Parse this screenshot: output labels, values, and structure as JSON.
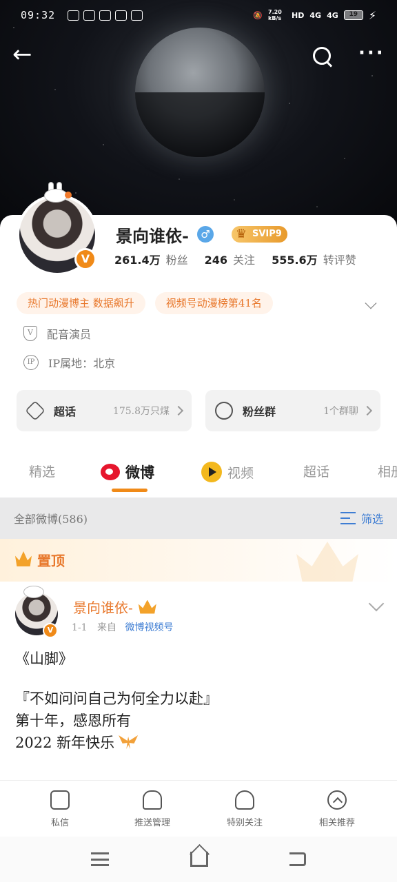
{
  "status_bar": {
    "time": "09:32",
    "network_speed": "7.20 kB/s",
    "hd": "HD",
    "signal1": "4G",
    "signal2": "4G",
    "battery": "19"
  },
  "header": {
    "back_icon": "arrow-left-icon",
    "search_icon": "search-icon",
    "more_icon": "more-dots-icon"
  },
  "profile": {
    "name": "景向谁依-",
    "gender": "male",
    "svip_label": "SVIP9",
    "verified_badge": "V",
    "stats": [
      {
        "value": "261.4万",
        "label": "粉丝"
      },
      {
        "value": "246",
        "label": "关注"
      },
      {
        "value": "555.6万",
        "label": "转评赞"
      }
    ],
    "tags": [
      "热门动漫博主 数据飙升",
      "视频号动漫榜第41名"
    ],
    "info": [
      {
        "icon": "shield-icon",
        "text": "配音演员"
      },
      {
        "icon": "ip-icon",
        "text": "IP属地：北京"
      }
    ],
    "boxes": [
      {
        "title": "超话",
        "sub": "175.8万只煤"
      },
      {
        "title": "粉丝群",
        "sub": "1个群聊"
      }
    ]
  },
  "tabs": [
    {
      "label": "精选"
    },
    {
      "label": "微博"
    },
    {
      "label": "视频"
    },
    {
      "label": "超话"
    },
    {
      "label": "相册"
    }
  ],
  "filter": {
    "all_label": "全部微博(586)",
    "filter_label": "筛选"
  },
  "pinned": {
    "label": "置顶"
  },
  "post": {
    "author": "景向谁依-",
    "date": "1-1",
    "source_prefix": "来自",
    "source": "微博视频号",
    "lines": [
      "《山脚》",
      "",
      "『不如问问自己为何全力以赴』",
      "第十年，感恩所有",
      "2022 新年快乐"
    ]
  },
  "actions": [
    {
      "label": "私信",
      "icon": "message-icon"
    },
    {
      "label": "推送管理",
      "icon": "bell-icon"
    },
    {
      "label": "特别关注",
      "icon": "person-star-icon"
    },
    {
      "label": "相关推荐",
      "icon": "chevron-up-circle-icon"
    }
  ],
  "colors": {
    "accent": "#f08a18",
    "link": "#3e7dd3",
    "tag_text": "#e8782c"
  }
}
